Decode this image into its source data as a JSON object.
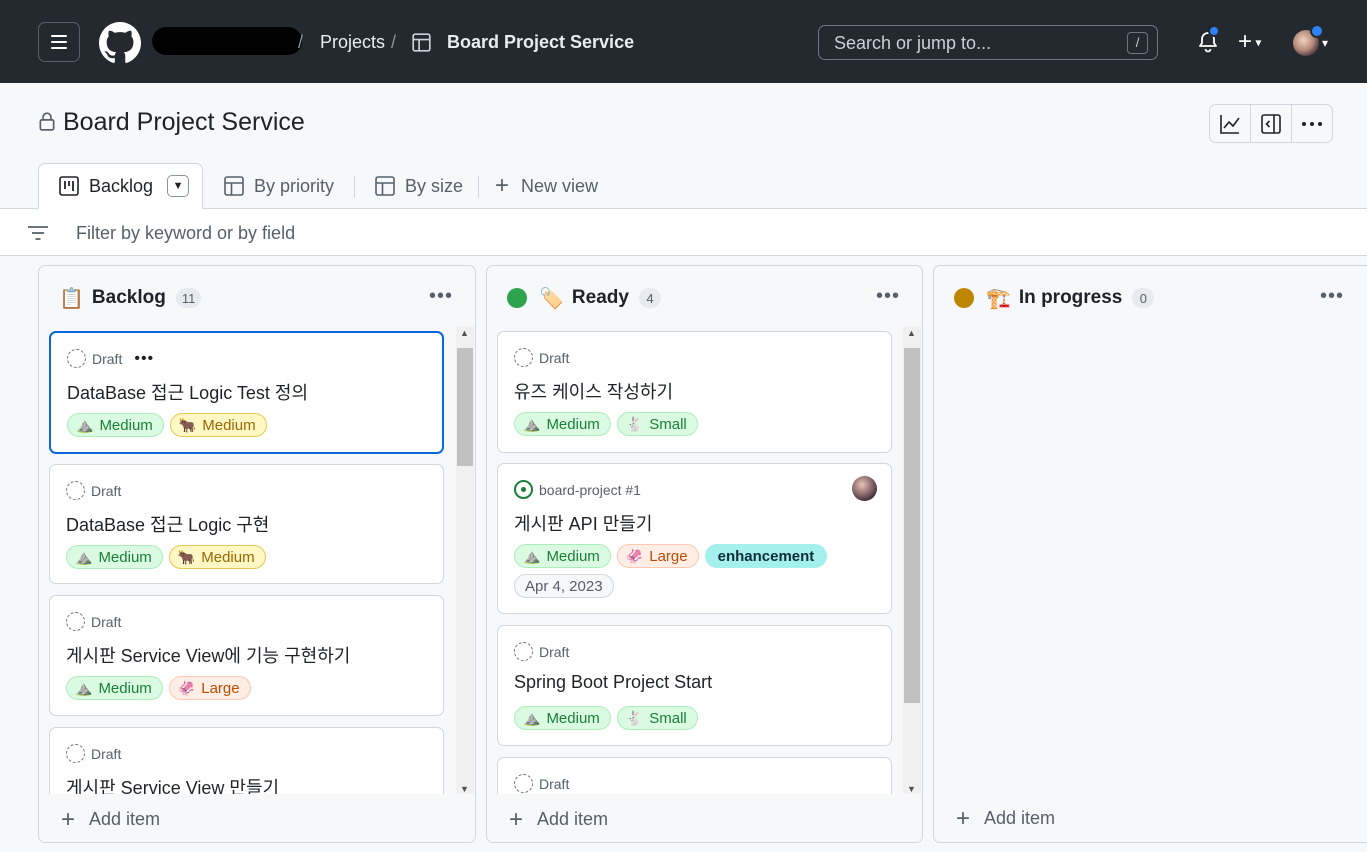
{
  "header": {
    "breadcrumb_projects": "Projects",
    "breadcrumb_current": "Board Project Service",
    "search_placeholder": "Search or jump to...",
    "search_shortcut": "/"
  },
  "project": {
    "title": "Board Project Service"
  },
  "views": {
    "tabs": [
      {
        "label": "Backlog",
        "icon": "board-icon",
        "active": true
      },
      {
        "label": "By priority",
        "icon": "table-icon"
      },
      {
        "label": "By size",
        "icon": "table-icon"
      },
      {
        "label": "New view",
        "icon": "plus-icon"
      }
    ]
  },
  "filter": {
    "placeholder": "Filter by keyword or by field"
  },
  "columns": [
    {
      "name": "Backlog",
      "emoji": "📋",
      "count": "11",
      "cards": [
        {
          "type": "Draft",
          "title": "DataBase 접근 Logic Test 정의",
          "labels": [
            {
              "emoji": "⛰️",
              "text": "Medium",
              "color": "green"
            },
            {
              "emoji": "🐂",
              "text": "Medium",
              "color": "yellow"
            }
          ]
        },
        {
          "type": "Draft",
          "title": "DataBase 접근 Logic 구현",
          "labels": [
            {
              "emoji": "⛰️",
              "text": "Medium",
              "color": "green"
            },
            {
              "emoji": "🐂",
              "text": "Medium",
              "color": "yellow"
            }
          ]
        },
        {
          "type": "Draft",
          "title": "게시판 Service View에 기능 구현하기",
          "labels": [
            {
              "emoji": "⛰️",
              "text": "Medium",
              "color": "green"
            },
            {
              "emoji": "🦑",
              "text": "Large",
              "color": "orange"
            }
          ]
        },
        {
          "type": "Draft",
          "title": "게시판 Service View 만들기"
        }
      ],
      "add_label": "Add item"
    },
    {
      "name": "Ready",
      "emoji": "🏷️",
      "status_color": "#2da44e",
      "count": "4",
      "cards": [
        {
          "type": "Draft",
          "title": "유즈 케이스 작성하기",
          "labels": [
            {
              "emoji": "⛰️",
              "text": "Medium",
              "color": "green"
            },
            {
              "emoji": "🐇",
              "text": "Small",
              "color": "green"
            }
          ]
        },
        {
          "type": "board-project #1",
          "title": "게시판 API 만들기",
          "labels": [
            {
              "emoji": "⛰️",
              "text": "Medium",
              "color": "green"
            },
            {
              "emoji": "🦑",
              "text": "Large",
              "color": "orange"
            },
            {
              "text": "enhancement",
              "color": "cyan"
            },
            {
              "text": "Apr 4, 2023",
              "color": "gray"
            }
          ]
        },
        {
          "type": "Draft",
          "title": "Spring Boot Project Start",
          "labels": [
            {
              "emoji": "⛰️",
              "text": "Medium",
              "color": "green"
            },
            {
              "emoji": "🐇",
              "text": "Small",
              "color": "green"
            }
          ]
        },
        {
          "type": "Draft",
          "title": ""
        }
      ],
      "add_label": "Add item"
    },
    {
      "name": "In progress",
      "emoji": "🏗️",
      "status_color": "#bf8700",
      "count": "0",
      "cards": [],
      "add_label": "Add item"
    }
  ]
}
